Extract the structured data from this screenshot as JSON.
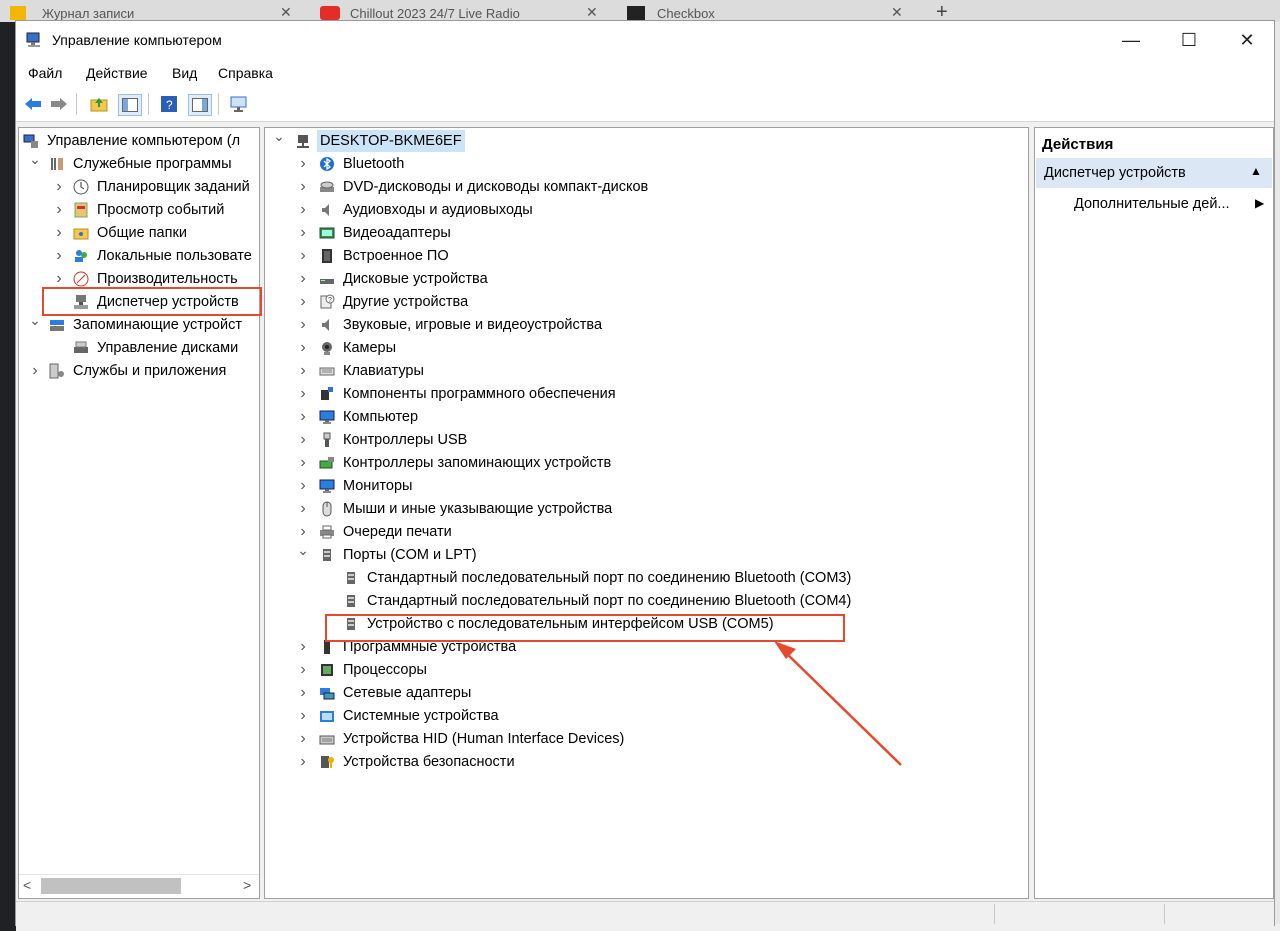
{
  "browser": {
    "tabs": [
      {
        "label": "Журнал записи"
      },
      {
        "label": "Chillout 2023 24/7 Live Radio"
      },
      {
        "label": "Checkbox"
      }
    ]
  },
  "window": {
    "title": "Управление компьютером",
    "controls": {
      "minimize": "—",
      "maximize": "☐",
      "close": "✕"
    }
  },
  "menu": [
    "Файл",
    "Действие",
    "Вид",
    "Справка"
  ],
  "left_tree": [
    {
      "label": "Управление компьютером (л",
      "level": 0,
      "chevron": "",
      "icon": "computer-management-icon"
    },
    {
      "label": "Служебные программы",
      "level": 1,
      "chevron": "down",
      "icon": "tools-icon"
    },
    {
      "label": "Планировщик заданий",
      "level": 2,
      "chevron": "right",
      "icon": "clock-icon"
    },
    {
      "label": "Просмотр событий",
      "level": 2,
      "chevron": "right",
      "icon": "event-viewer-icon"
    },
    {
      "label": "Общие папки",
      "level": 2,
      "chevron": "right",
      "icon": "shared-folder-icon"
    },
    {
      "label": "Локальные пользовате",
      "level": 2,
      "chevron": "right",
      "icon": "users-icon"
    },
    {
      "label": "Производительность",
      "level": 2,
      "chevron": "right",
      "icon": "performance-icon"
    },
    {
      "label": "Диспетчер устройств",
      "level": 2,
      "chevron": "",
      "icon": "device-manager-icon",
      "selected": true
    },
    {
      "label": "Запоминающие устройст",
      "level": 1,
      "chevron": "down",
      "icon": "storage-icon"
    },
    {
      "label": "Управление дисками",
      "level": 2,
      "chevron": "",
      "icon": "disk-icon"
    },
    {
      "label": "Службы и приложения",
      "level": 1,
      "chevron": "right",
      "icon": "services-icon"
    }
  ],
  "device_tree": {
    "root": "DESKTOP-BKME6EF",
    "items": [
      {
        "label": "Bluetooth",
        "icon": "bluetooth-icon",
        "chevron": "right"
      },
      {
        "label": "DVD-дисководы и дисководы компакт-дисков",
        "icon": "dvd-icon",
        "chevron": "right"
      },
      {
        "label": "Аудиовходы и аудиовыходы",
        "icon": "speaker-icon",
        "chevron": "right"
      },
      {
        "label": "Видеоадаптеры",
        "icon": "display-adapter-icon",
        "chevron": "right"
      },
      {
        "label": "Встроенное ПО",
        "icon": "firmware-icon",
        "chevron": "right"
      },
      {
        "label": "Дисковые устройства",
        "icon": "disk-drive-icon",
        "chevron": "right"
      },
      {
        "label": "Другие устройства",
        "icon": "unknown-device-icon",
        "chevron": "right"
      },
      {
        "label": "Звуковые, игровые и видеоустройства",
        "icon": "speaker-icon",
        "chevron": "right"
      },
      {
        "label": "Камеры",
        "icon": "camera-icon",
        "chevron": "right"
      },
      {
        "label": "Клавиатуры",
        "icon": "keyboard-icon",
        "chevron": "right"
      },
      {
        "label": "Компоненты программного обеспечения",
        "icon": "software-component-icon",
        "chevron": "right"
      },
      {
        "label": "Компьютер",
        "icon": "monitor-icon",
        "chevron": "right"
      },
      {
        "label": "Контроллеры USB",
        "icon": "usb-icon",
        "chevron": "right"
      },
      {
        "label": "Контроллеры запоминающих устройств",
        "icon": "storage-controller-icon",
        "chevron": "right"
      },
      {
        "label": "Мониторы",
        "icon": "monitor-icon",
        "chevron": "right"
      },
      {
        "label": "Мыши и иные указывающие устройства",
        "icon": "mouse-icon",
        "chevron": "right"
      },
      {
        "label": "Очереди печати",
        "icon": "printer-icon",
        "chevron": "right"
      },
      {
        "label": "Порты (COM и LPT)",
        "icon": "port-icon",
        "chevron": "down"
      },
      {
        "label": "Стандартный последовательный порт по соединению Bluetooth (COM3)",
        "icon": "port-icon",
        "chevron": "",
        "child": true
      },
      {
        "label": "Стандартный последовательный порт по соединению Bluetooth (COM4)",
        "icon": "port-icon",
        "chevron": "",
        "child": true
      },
      {
        "label": "Устройство с последовательным интерфейсом USB (COM5)",
        "icon": "port-icon",
        "chevron": "",
        "child": true,
        "highlighted": true
      },
      {
        "label": "Программные устройства",
        "icon": "software-device-icon",
        "chevron": "right"
      },
      {
        "label": "Процессоры",
        "icon": "processor-icon",
        "chevron": "right"
      },
      {
        "label": "Сетевые адаптеры",
        "icon": "network-adapter-icon",
        "chevron": "right"
      },
      {
        "label": "Системные устройства",
        "icon": "system-device-icon",
        "chevron": "right"
      },
      {
        "label": "Устройства HID (Human Interface Devices)",
        "icon": "hid-icon",
        "chevron": "right"
      },
      {
        "label": "Устройства безопасности",
        "icon": "security-device-icon",
        "chevron": "right"
      }
    ]
  },
  "actions": {
    "title": "Действия",
    "section": "Диспетчер устройств",
    "more": "Дополнительные дей..."
  },
  "colors": {
    "annotation": "#e64a2e",
    "selection": "#cce4f7",
    "section_bg": "#dbe7f5"
  }
}
